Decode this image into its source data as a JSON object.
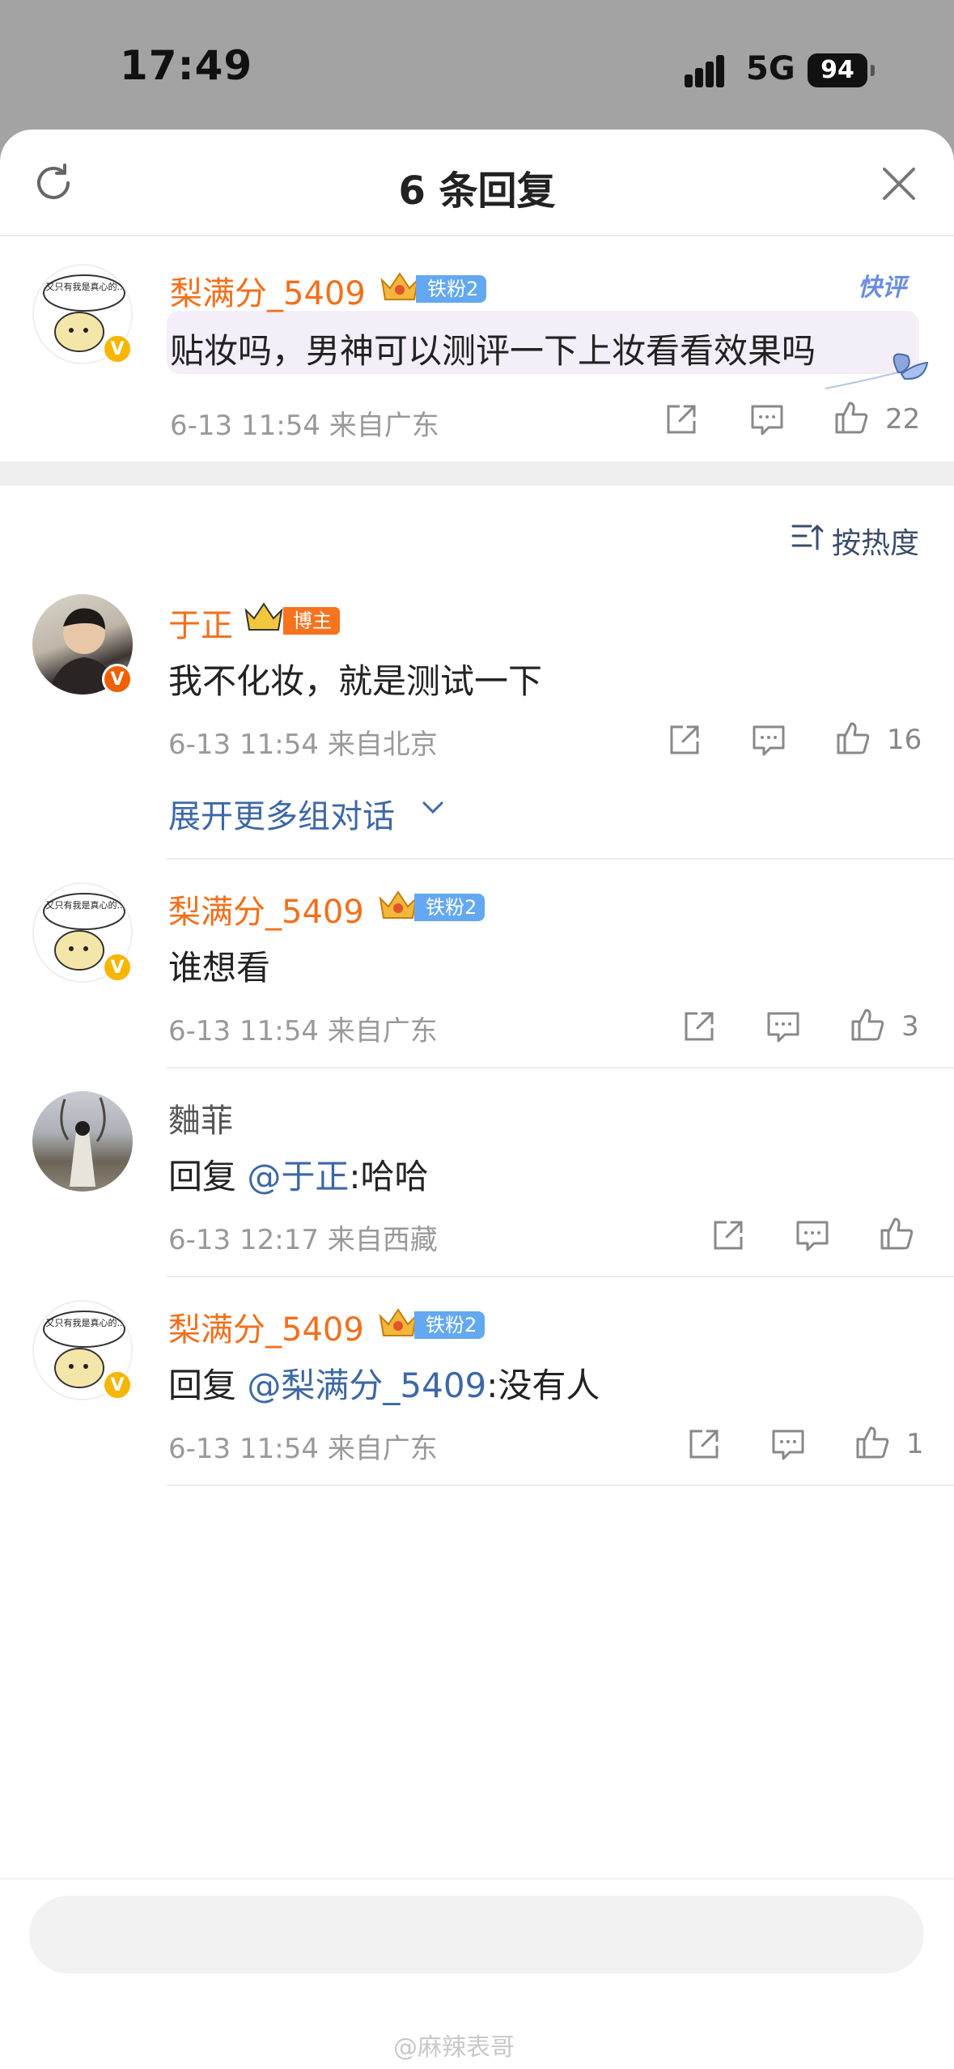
{
  "status_bar": {
    "time": "17:49",
    "network": "5G",
    "battery": "94"
  },
  "header": {
    "title": "6 条回复"
  },
  "main_comment": {
    "user": "梨满分_5409",
    "fan_badge": "铁粉2",
    "text": "贴妆吗，男神可以测评一下上妆看看效果吗",
    "time_location": "6-13 11:54  来自广东",
    "likes": "22",
    "quick_review_label": "快评"
  },
  "sort": {
    "label": "按热度"
  },
  "replies": [
    {
      "user": "于正",
      "role_badge": "博主",
      "text": "我不化妆，就是测试一下",
      "time_location": "6-13 11:54  来自北京",
      "likes": "16",
      "expand_label": "展开更多组对话"
    },
    {
      "user": "梨满分_5409",
      "fan_badge": "铁粉2",
      "text": "谁想看",
      "time_location": "6-13 11:54  来自广东",
      "likes": "3"
    },
    {
      "user": "麯菲",
      "text_prefix": "回复",
      "mention": "@于正",
      "text_suffix": ":哈哈",
      "time_location": "6-13 12:17  来自西藏",
      "likes": ""
    },
    {
      "user": "梨满分_5409",
      "fan_badge": "铁粉2",
      "text_prefix": "回复",
      "mention": "@梨满分_5409",
      "text_suffix": ":没有人",
      "time_location": "6-13 11:54  来自广东",
      "likes": "1"
    }
  ],
  "avatar_sticker_text": "又只有我是真心的..",
  "watermark": "@麻辣表哥",
  "colors": {
    "username_orange": "#f26f1b",
    "mention_blue": "#3d68a6",
    "fan_badge_blue": "#63a8f0"
  }
}
